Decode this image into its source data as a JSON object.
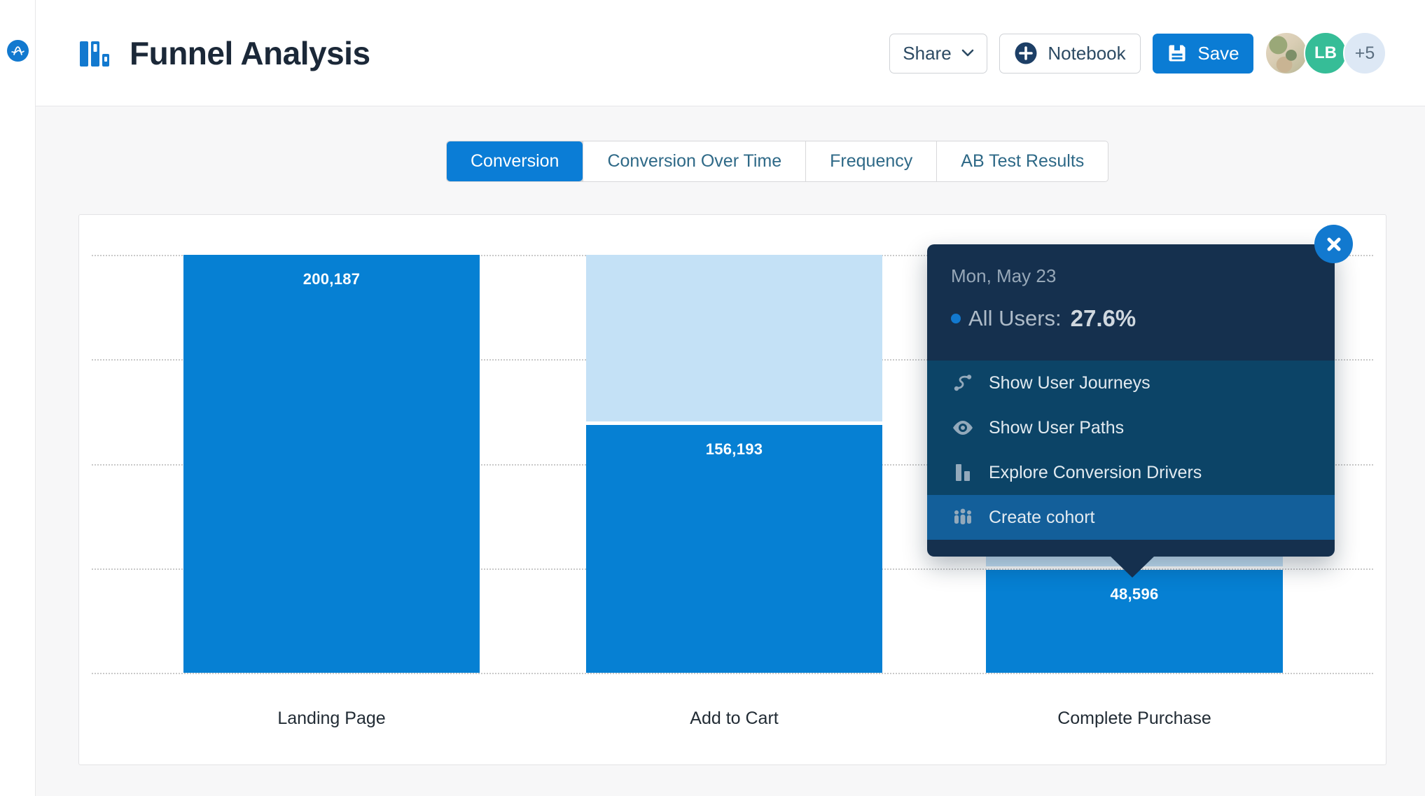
{
  "app": {
    "logo_icon": "amplitude-logo",
    "title": "Funnel Analysis",
    "title_icon": "bar-chart-logo-icon"
  },
  "toolbar": {
    "share_label": "Share",
    "notebook_label": "Notebook",
    "save_label": "Save",
    "avatars": [
      {
        "kind": "photo",
        "label": ""
      },
      {
        "kind": "initials",
        "label": "LB"
      },
      {
        "kind": "overflow",
        "label": "+5"
      }
    ]
  },
  "tabs": [
    {
      "label": "Conversion",
      "active": true
    },
    {
      "label": "Conversion Over Time",
      "active": false
    },
    {
      "label": "Frequency",
      "active": false
    },
    {
      "label": "AB Test Results",
      "active": false
    }
  ],
  "chart_data": {
    "type": "funnel_bar",
    "title": "Funnel Analysis — Conversion",
    "categories": [
      "Landing Page",
      "Add to Cart",
      "Complete Purchase"
    ],
    "series": [
      {
        "name": "All Users",
        "values": [
          200187,
          156193,
          48596
        ]
      }
    ],
    "value_labels": [
      "200,187",
      "156,193",
      "48,596"
    ],
    "dropoff_bars_shown": true,
    "ylim": [
      0,
      200187
    ],
    "grid": "horizontal-dotted-5",
    "legend": "none",
    "rendered": {
      "converted_height_pct": [
        100,
        59.3,
        24.6
      ],
      "dropoff_total_height_pct": [
        null,
        100,
        78
      ]
    }
  },
  "tooltip": {
    "date": "Mon, May 23",
    "series_name": "All Users:",
    "series_value": "27.6%",
    "close_icon": "close-icon",
    "menu": [
      {
        "label": "Show User Journeys",
        "icon": "journey-icon",
        "highlighted": false
      },
      {
        "label": "Show User Paths",
        "icon": "eye-icon",
        "highlighted": false
      },
      {
        "label": "Explore Conversion Drivers",
        "icon": "bars-icon",
        "highlighted": false
      },
      {
        "label": "Create cohort",
        "icon": "cohort-icon",
        "highlighted": true
      }
    ]
  },
  "colors": {
    "primary_blue": "#0680d3",
    "light_blue_dropoff": "#c4e1f6",
    "tooltip_header_navy": "#15304e",
    "tooltip_menu_navy": "#0c4467",
    "tooltip_highlight_blue": "#135f9a",
    "logo_blue": "#1279cf",
    "avatar_teal": "#36bd97",
    "page_background": "#f7f7f8"
  }
}
